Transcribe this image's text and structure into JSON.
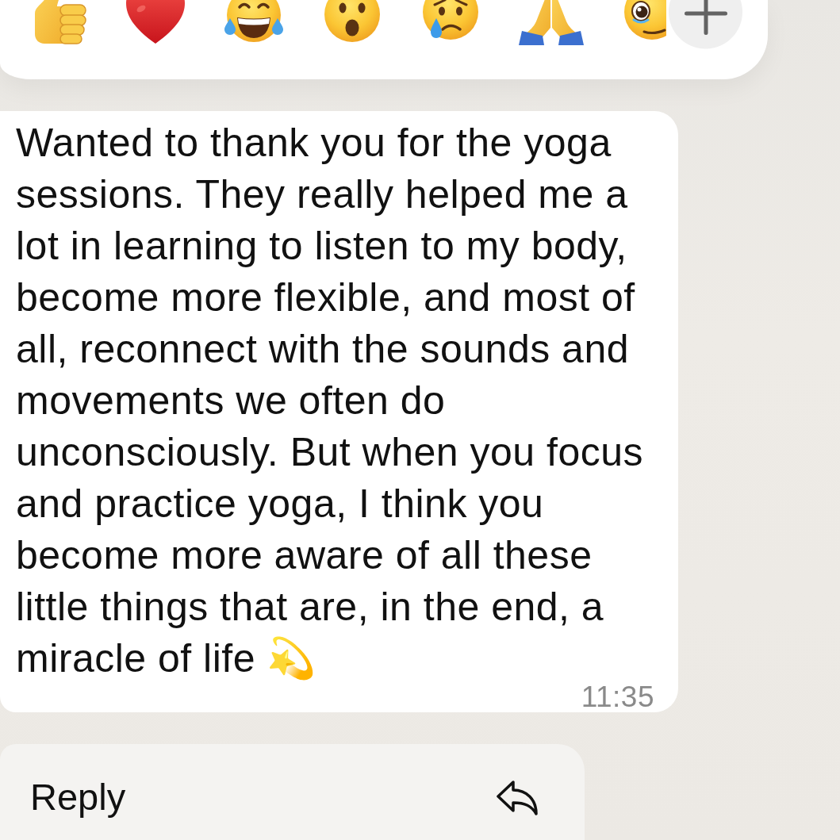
{
  "reaction_bar": {
    "reactions": [
      {
        "kind": "thumbs-up"
      },
      {
        "kind": "heart"
      },
      {
        "kind": "tears-of-joy"
      },
      {
        "kind": "surprised"
      },
      {
        "kind": "crying"
      },
      {
        "kind": "praying-hands"
      },
      {
        "kind": "teary-eyes"
      }
    ]
  },
  "message": {
    "text": "Wanted to thank you for the yoga sessions. They really helped me a lot in learning to listen to my body, become more flexible, and most of all, reconnect with the sounds and movements we often do unconsciously. But when you focus and practice yoga, I think you become more aware of all these little things that are, in the end, a miracle of life 💫",
    "time": "11:35"
  },
  "menu": [
    {
      "kind": "reply",
      "label": "Reply"
    }
  ]
}
